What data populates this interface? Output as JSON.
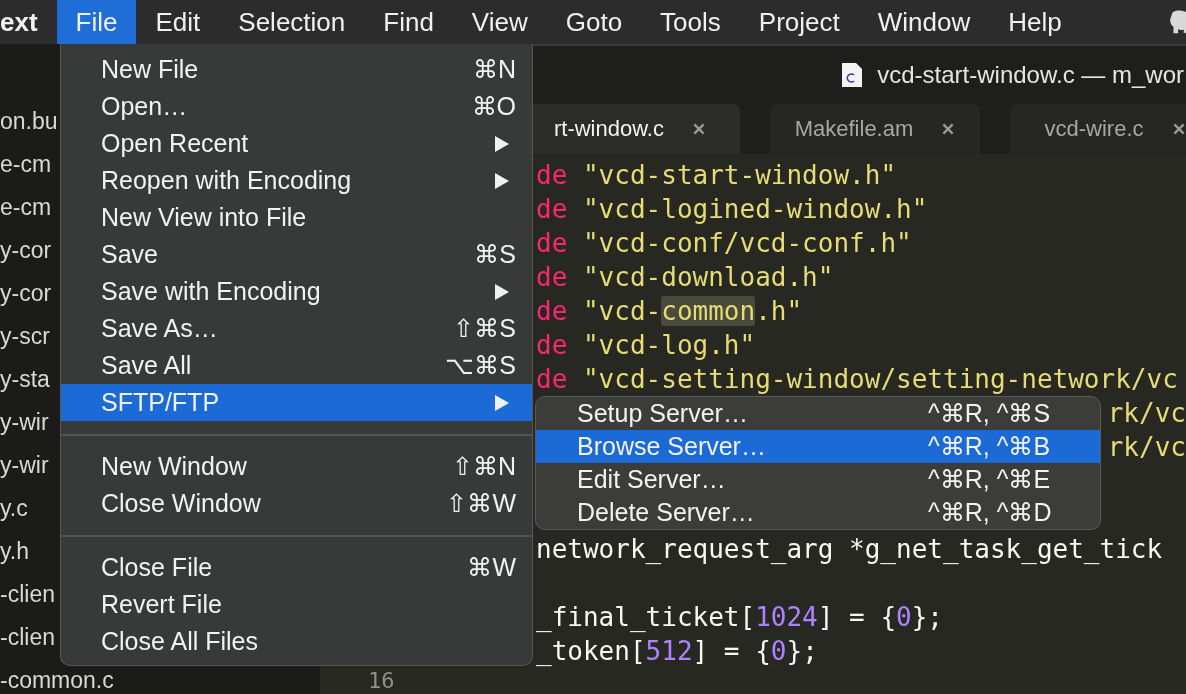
{
  "menu_bar": {
    "app_name": "ext",
    "items": [
      {
        "label": "File",
        "selected": true
      },
      {
        "label": "Edit",
        "selected": false
      },
      {
        "label": "Selection",
        "selected": false
      },
      {
        "label": "Find",
        "selected": false
      },
      {
        "label": "View",
        "selected": false
      },
      {
        "label": "Goto",
        "selected": false
      },
      {
        "label": "Tools",
        "selected": false
      },
      {
        "label": "Project",
        "selected": false
      },
      {
        "label": "Window",
        "selected": false
      },
      {
        "label": "Help",
        "selected": false
      }
    ]
  },
  "sidebar": {
    "items": [
      "on.bu",
      "e-cm",
      "e-cm",
      "y-cor",
      "y-cor",
      "y-scr",
      "y-sta",
      "y-wir",
      "y-wir",
      "y.c",
      "y.h",
      "-clien",
      "-clien",
      "-common.c"
    ]
  },
  "window": {
    "title": "vcd-start-window.c — m_wor"
  },
  "tabs": [
    {
      "label": "rt-window.c",
      "selected": true
    },
    {
      "label": "Makefile.am",
      "selected": false
    },
    {
      "label": "vcd-wire.c",
      "selected": false
    }
  ],
  "code_lines": [
    {
      "kind": "code",
      "segments": [
        {
          "text": "de",
          "kind": "keyword"
        },
        {
          "text": " \"vcd-start-window.h\"",
          "kind": "string"
        }
      ]
    },
    {
      "kind": "code",
      "segments": [
        {
          "text": "de",
          "kind": "keyword"
        },
        {
          "text": " \"vcd-logined-window.h\"",
          "kind": "string"
        }
      ]
    },
    {
      "kind": "code",
      "segments": [
        {
          "text": "de",
          "kind": "keyword"
        },
        {
          "text": " \"vcd-conf/vcd-conf.h\"",
          "kind": "string"
        }
      ]
    },
    {
      "kind": "code",
      "segments": [
        {
          "text": "de",
          "kind": "keyword"
        },
        {
          "text": " \"vcd-download.h\"",
          "kind": "string"
        }
      ]
    },
    {
      "kind": "code",
      "segments": [
        {
          "text": "de",
          "kind": "keyword"
        },
        {
          "text": " \"vcd-",
          "kind": "string"
        },
        {
          "text": "common",
          "kind": "match"
        },
        {
          "text": ".h\"",
          "kind": "string"
        }
      ]
    },
    {
      "kind": "code",
      "segments": [
        {
          "text": "de",
          "kind": "keyword"
        },
        {
          "text": " \"vcd-log.h\"",
          "kind": "string"
        }
      ]
    },
    {
      "kind": "code",
      "segments": [
        {
          "text": "de",
          "kind": "keyword"
        },
        {
          "text": " \"vcd-setting-window/setting-network/vc",
          "kind": "string"
        }
      ]
    },
    {
      "kind": "tail",
      "text": "rk/vc"
    },
    {
      "kind": "tail",
      "text": "rk/vc"
    },
    {
      "kind": "blank"
    },
    {
      "kind": "blank"
    },
    {
      "kind": "code",
      "segments": [
        {
          "text": "network_request_arg *g_net_task_get_tick",
          "kind": "plain"
        }
      ]
    },
    {
      "kind": "blank"
    },
    {
      "kind": "code",
      "segments": [
        {
          "text": "_final_ticket[",
          "kind": "plain"
        },
        {
          "text": "1024",
          "kind": "number"
        },
        {
          "text": "] = {",
          "kind": "plain"
        },
        {
          "text": "0",
          "kind": "number"
        },
        {
          "text": "};",
          "kind": "plain"
        }
      ]
    },
    {
      "kind": "code",
      "segments": [
        {
          "text": "_token[",
          "kind": "plain"
        },
        {
          "text": "512",
          "kind": "number"
        },
        {
          "text": "] = {",
          "kind": "plain"
        },
        {
          "text": "0",
          "kind": "number"
        },
        {
          "text": "};",
          "kind": "plain"
        }
      ]
    }
  ],
  "gutter": {
    "line_number": "16"
  },
  "file_menu": [
    {
      "kind": "item",
      "label": "New File",
      "shortcut": "⌘N",
      "submenu": false,
      "selected": false
    },
    {
      "kind": "item",
      "label": "Open…",
      "shortcut": "⌘O",
      "submenu": false,
      "selected": false
    },
    {
      "kind": "item",
      "label": "Open Recent",
      "submenu": true,
      "selected": false
    },
    {
      "kind": "item",
      "label": "Reopen with Encoding",
      "submenu": true,
      "selected": false
    },
    {
      "kind": "item",
      "label": "New View into File",
      "submenu": false,
      "selected": false
    },
    {
      "kind": "item",
      "label": "Save",
      "shortcut": "⌘S",
      "submenu": false,
      "selected": false
    },
    {
      "kind": "item",
      "label": "Save with Encoding",
      "submenu": true,
      "selected": false
    },
    {
      "kind": "item",
      "label": "Save As…",
      "shortcut": "⇧⌘S",
      "submenu": false,
      "selected": false
    },
    {
      "kind": "item",
      "label": "Save All",
      "shortcut": "⌥⌘S",
      "submenu": false,
      "selected": false
    },
    {
      "kind": "item",
      "label": "SFTP/FTP",
      "submenu": true,
      "selected": true
    },
    {
      "kind": "separator"
    },
    {
      "kind": "item",
      "label": "New Window",
      "shortcut": "⇧⌘N",
      "submenu": false,
      "selected": false
    },
    {
      "kind": "item",
      "label": "Close Window",
      "shortcut": "⇧⌘W",
      "submenu": false,
      "selected": false
    },
    {
      "kind": "separator"
    },
    {
      "kind": "item",
      "label": "Close File",
      "shortcut": "⌘W",
      "submenu": false,
      "selected": false
    },
    {
      "kind": "item",
      "label": "Revert File",
      "submenu": false,
      "selected": false
    },
    {
      "kind": "item",
      "label": "Close All Files",
      "submenu": false,
      "selected": false
    }
  ],
  "sftp_submenu": [
    {
      "label": "Setup Server…",
      "shortcut": "^⌘R, ^⌘S",
      "selected": false
    },
    {
      "label": "Browse Server…",
      "shortcut": "^⌘R, ^⌘B",
      "selected": true
    },
    {
      "label": "Edit Server…",
      "shortcut": "^⌘R, ^⌘E",
      "selected": false
    },
    {
      "label": "Delete Server…",
      "shortcut": "^⌘R, ^⌘D",
      "selected": false
    }
  ]
}
